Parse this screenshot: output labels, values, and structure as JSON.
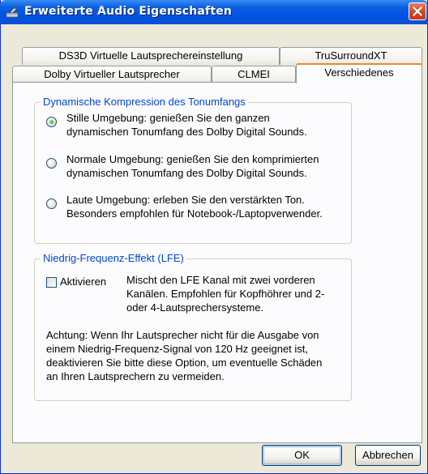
{
  "window": {
    "title": "Erweiterte Audio Eigenschaften",
    "icon": "speaker-settings-icon",
    "close_icon": "close-icon"
  },
  "tabs": {
    "row1": [
      "DS3D Virtuelle Lautsprechereinstellung",
      "TruSurroundXT"
    ],
    "row2": [
      "Dolby Virtueller Lautsprecher",
      "CLMEI",
      "Verschiedenes"
    ],
    "active": "Verschiedenes"
  },
  "compression": {
    "title": "Dynamische Kompression des Tonumfangs",
    "options": [
      {
        "lines": [
          "Stille Umgebung: genießen Sie den ganzen",
          "dynamischen Tonumfang des Dolby Digital Sounds."
        ],
        "selected": true
      },
      {
        "lines": [
          "Normale Umgebung: genießen Sie den komprimierten",
          "dynamischen Tonumfang des Dolby Digital Sounds."
        ],
        "selected": false
      },
      {
        "lines": [
          "Laute Umgebung: erleben Sie den verstärkten Ton.",
          "Besonders empfohlen für Notebook-/Laptopverwender."
        ],
        "selected": false
      }
    ]
  },
  "lfe": {
    "title": "Niedrig-Frequenz-Effekt (LFE)",
    "checkbox_label": "Aktivieren",
    "checked": false,
    "description": [
      "Mischt den LFE Kanal mit zwei vorderen",
      "Kanälen. Empfohlen für Kopfhöhrer und 2-",
      "oder 4-Lautsprechersysteme."
    ],
    "warning": [
      "Achtung: Wenn Ihr Lautsprecher nicht für die Ausgabe von",
      "einem Niedrig-Frequenz-Signal von 120 Hz geeignet ist,",
      "deaktivieren Sie bitte diese Option, um eventuelle Schäden",
      "an Ihren Lautsprechern zu vermeiden."
    ]
  },
  "buttons": {
    "ok": "OK",
    "cancel": "Abbrechen"
  },
  "colors": {
    "titlebar": "#0054e3",
    "group_title": "#0046d5",
    "active_tab_accent": "#e68b2c",
    "radio_dot": "#21a121"
  }
}
